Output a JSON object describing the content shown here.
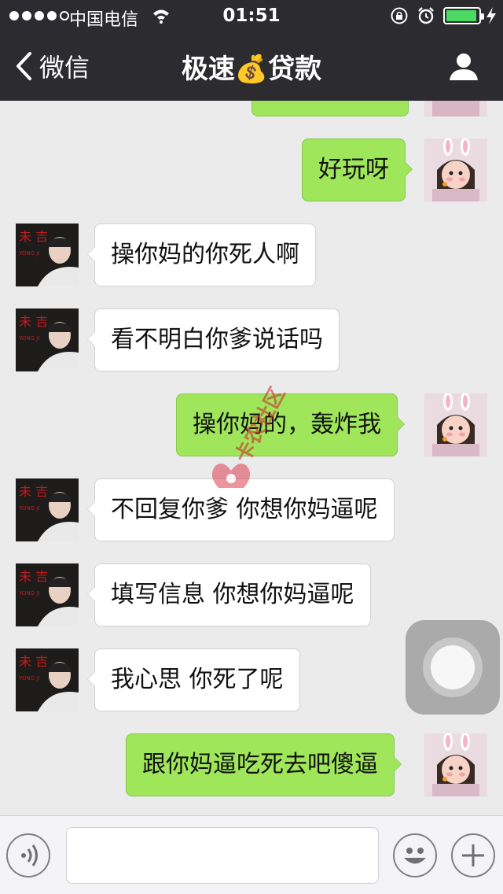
{
  "status_bar": {
    "carrier": "中国电信",
    "time": "01:51",
    "signal_bars_filled": 4,
    "battery_level_percent": 90
  },
  "nav": {
    "back_label": "微信",
    "title": "极速💰贷款"
  },
  "messages": [
    {
      "side": "out",
      "text": ""
    },
    {
      "side": "out",
      "text": "好玩呀"
    },
    {
      "side": "in",
      "text": "操你妈的你死人啊"
    },
    {
      "side": "in",
      "text": "看不明白你爹说话吗"
    },
    {
      "side": "out",
      "text": "操你妈的，轰炸我"
    },
    {
      "side": "in",
      "text": "不回复你爹 你想你妈逼呢"
    },
    {
      "side": "in",
      "text": "填写信息 你想你妈逼呢"
    },
    {
      "side": "in",
      "text": "我心思 你死了呢"
    },
    {
      "side": "out",
      "text": "跟你妈逼吃死去吧傻逼"
    }
  ],
  "watermark_text": "卡农社区",
  "colors": {
    "nav_background": "#2b2b30",
    "chat_background": "#ebebeb",
    "outgoing_bubble": "#9fe65a",
    "incoming_bubble": "#ffffff",
    "battery": "#4cd964"
  },
  "icons": [
    "back-chevron-icon",
    "profile-icon",
    "voice-icon",
    "emoji-icon",
    "plus-icon",
    "wifi-icon",
    "lock-rotation-icon",
    "alarm-icon",
    "charging-bolt-icon"
  ]
}
